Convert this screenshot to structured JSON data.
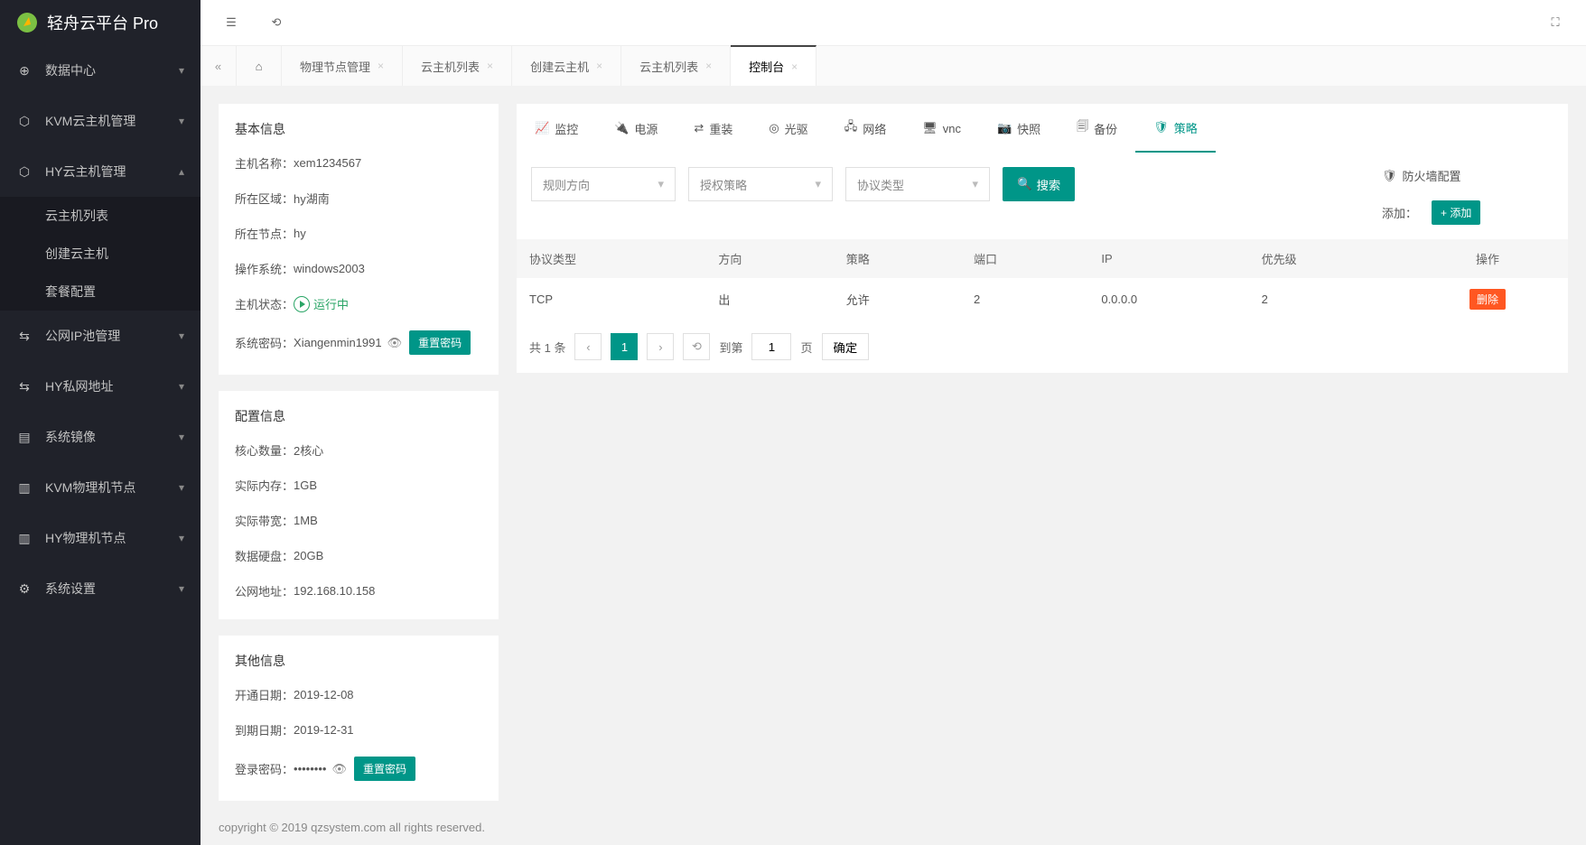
{
  "brand": "轻舟云平台 Pro",
  "sidebar": [
    {
      "icon": "⊕",
      "label": "数据中心",
      "open": false
    },
    {
      "icon": "⬡",
      "label": "KVM云主机管理",
      "open": false
    },
    {
      "icon": "⬡",
      "label": "HY云主机管理",
      "open": true,
      "children": [
        {
          "label": "云主机列表"
        },
        {
          "label": "创建云主机"
        },
        {
          "label": "套餐配置"
        }
      ]
    },
    {
      "icon": "⇆",
      "label": "公网IP池管理",
      "open": false
    },
    {
      "icon": "⇆",
      "label": "HY私网地址",
      "open": false
    },
    {
      "icon": "▤",
      "label": "系统镜像",
      "open": false
    },
    {
      "icon": "▥",
      "label": "KVM物理机节点",
      "open": false
    },
    {
      "icon": "▥",
      "label": "HY物理机节点",
      "open": false
    },
    {
      "icon": "⚙",
      "label": "系统设置",
      "open": false
    }
  ],
  "tabs": [
    {
      "label": "物理节点管理"
    },
    {
      "label": "云主机列表"
    },
    {
      "label": "创建云主机"
    },
    {
      "label": "云主机列表"
    },
    {
      "label": "控制台",
      "active": true
    }
  ],
  "basic": {
    "title": "基本信息",
    "host_lbl": "主机名称",
    "host": "xem1234567",
    "region_lbl": "所在区域",
    "region": "hy湖南",
    "node_lbl": "所在节点",
    "node": "hy",
    "os_lbl": "操作系统",
    "os": "windows2003",
    "status_lbl": "主机状态",
    "status": "运行中",
    "syspwd_lbl": "系统密码",
    "syspwd": "Xiangenmin1991",
    "reset_btn": "重置密码"
  },
  "config": {
    "title": "配置信息",
    "cores_lbl": "核心数量",
    "cores": "2核心",
    "mem_lbl": "实际内存",
    "mem": "1GB",
    "bw_lbl": "实际带宽",
    "bw": "1MB",
    "disk_lbl": "数据硬盘",
    "disk": "20GB",
    "ip_lbl": "公网地址",
    "ip": "192.168.10.158"
  },
  "other": {
    "title": "其他信息",
    "open_lbl": "开通日期",
    "open": "2019-12-08",
    "expire_lbl": "到期日期",
    "expire": "2019-12-31",
    "pwd_lbl": "登录密码",
    "pwd": "••••••••",
    "reset_btn": "重置密码"
  },
  "top_tabs": [
    {
      "icon": "📈",
      "label": "监控"
    },
    {
      "icon": "🔌",
      "label": "电源"
    },
    {
      "icon": "⇄",
      "label": "重装"
    },
    {
      "icon": "◎",
      "label": "光驱"
    },
    {
      "icon": "🖧",
      "label": "网络"
    },
    {
      "icon": "🖥",
      "label": "vnc"
    },
    {
      "icon": "📷",
      "label": "快照"
    },
    {
      "icon": "🗐",
      "label": "备份"
    },
    {
      "icon": "🛡",
      "label": "策略",
      "active": true
    }
  ],
  "filters": {
    "direction": "规则方向",
    "policy": "授权策略",
    "protocol": "协议类型",
    "search": "搜索"
  },
  "firewall": {
    "title": "防火墙配置",
    "add_lbl": "添加：",
    "add_btn": "添加"
  },
  "table": {
    "headers": [
      "协议类型",
      "方向",
      "策略",
      "端口",
      "IP",
      "优先级",
      "操作"
    ],
    "rows": [
      {
        "protocol": "TCP",
        "direction": "出",
        "policy": "允许",
        "port": "2",
        "ip": "0.0.0.0",
        "priority": "2",
        "del": "删除"
      }
    ]
  },
  "pager": {
    "total": "共 1 条",
    "page": "1",
    "goto_lbl": "到第",
    "goto_val": "1",
    "page_unit": "页",
    "ok": "确定"
  },
  "footer": "copyright © 2019 qzsystem.com all rights reserved."
}
